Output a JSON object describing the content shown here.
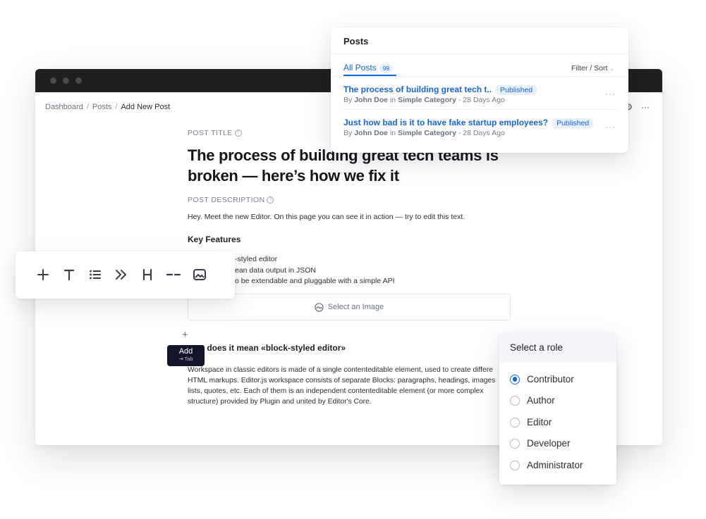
{
  "browser": {
    "breadcrumb": [
      "Dashboard",
      "Posts",
      "Add New Post"
    ]
  },
  "editor": {
    "title_label": "POST TITLE",
    "title": "The process of building great tech teams is broken — here’s how we fix it",
    "desc_label": "POST DESCRIPTION",
    "description": "Hey. Meet the new Editor. On this page you can see it in action — try to edit this text.",
    "key_features_heading": "Key Features",
    "features": [
      "-styled editor",
      "ean data output in JSON",
      "o be extendable and pluggable with a simple API"
    ],
    "select_image": "Select an Image",
    "section_heading": "t does it mean «block-styled editor»",
    "paragraph": "Workspace in classic editors is made of a single contenteditable element, used to create differe HTML markups. Editor.js workspace consists of separate Blocks: paragraphs, headings, images lists, quotes, etc. Each of them is an independent contenteditable element (or more complex structure) provided by Plugin and united by Editor's Core."
  },
  "tooltip": {
    "label": "Add",
    "shortcut": "⇥ Tab"
  },
  "toolbar": {
    "tools": [
      "plus-icon",
      "text-icon",
      "list-icon",
      "quote-icon",
      "heading-icon",
      "delimiter-icon",
      "image-icon"
    ]
  },
  "posts_panel": {
    "title": "Posts",
    "tab_label": "All Posts",
    "tab_count": "99",
    "filter_label": "Filter / Sort",
    "posts": [
      {
        "title": "The process of building great tech t..",
        "status": "Published",
        "by": "By",
        "author": "John Doe",
        "in": "in",
        "category": "Simple Category",
        "time": "- 28 Days Ago"
      },
      {
        "title": "Just how bad is it to have fake startup employees?",
        "status": "Published",
        "by": "By",
        "author": "John Doe",
        "in": "in",
        "category": "Simple Category",
        "time": "- 28 Days Ago"
      }
    ]
  },
  "role_panel": {
    "title": "Select a role",
    "roles": [
      "Contributor",
      "Author",
      "Editor",
      "Developer",
      "Administrator"
    ],
    "selected": "Contributor"
  },
  "colors": {
    "accent": "#1565e0",
    "titlebar": "#1f1f21",
    "tooltip_bg": "#14142b"
  }
}
